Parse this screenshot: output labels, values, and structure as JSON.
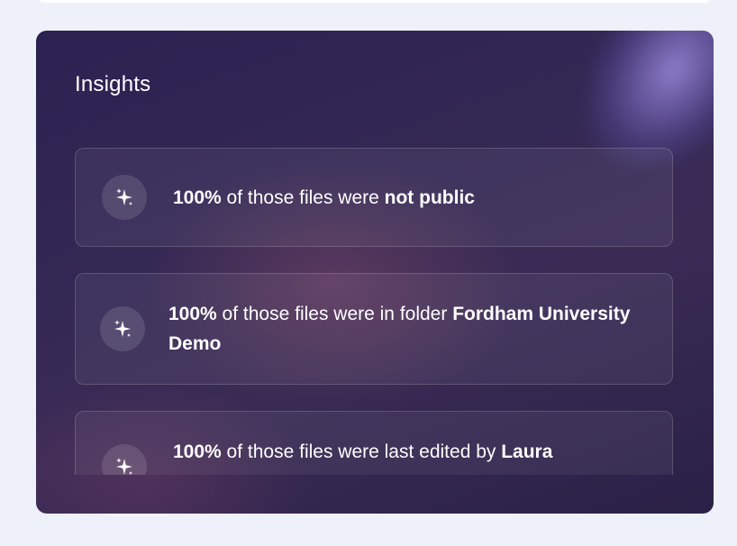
{
  "panel": {
    "title": "Insights"
  },
  "insights": [
    {
      "percent": "100%",
      "text": " of those files were ",
      "highlight": "not public"
    },
    {
      "percent": "100%",
      "text": " of those files were in folder ",
      "highlight": "Fordham University Demo"
    },
    {
      "percent": "100%",
      "text": " of those files were last edited by ",
      "highlight": "Laura"
    }
  ],
  "icons": {
    "insight": "sparkles-icon"
  },
  "colors": {
    "page_background": "#eef1f9",
    "panel_background": "#2b2252",
    "text": "#ffffff"
  }
}
